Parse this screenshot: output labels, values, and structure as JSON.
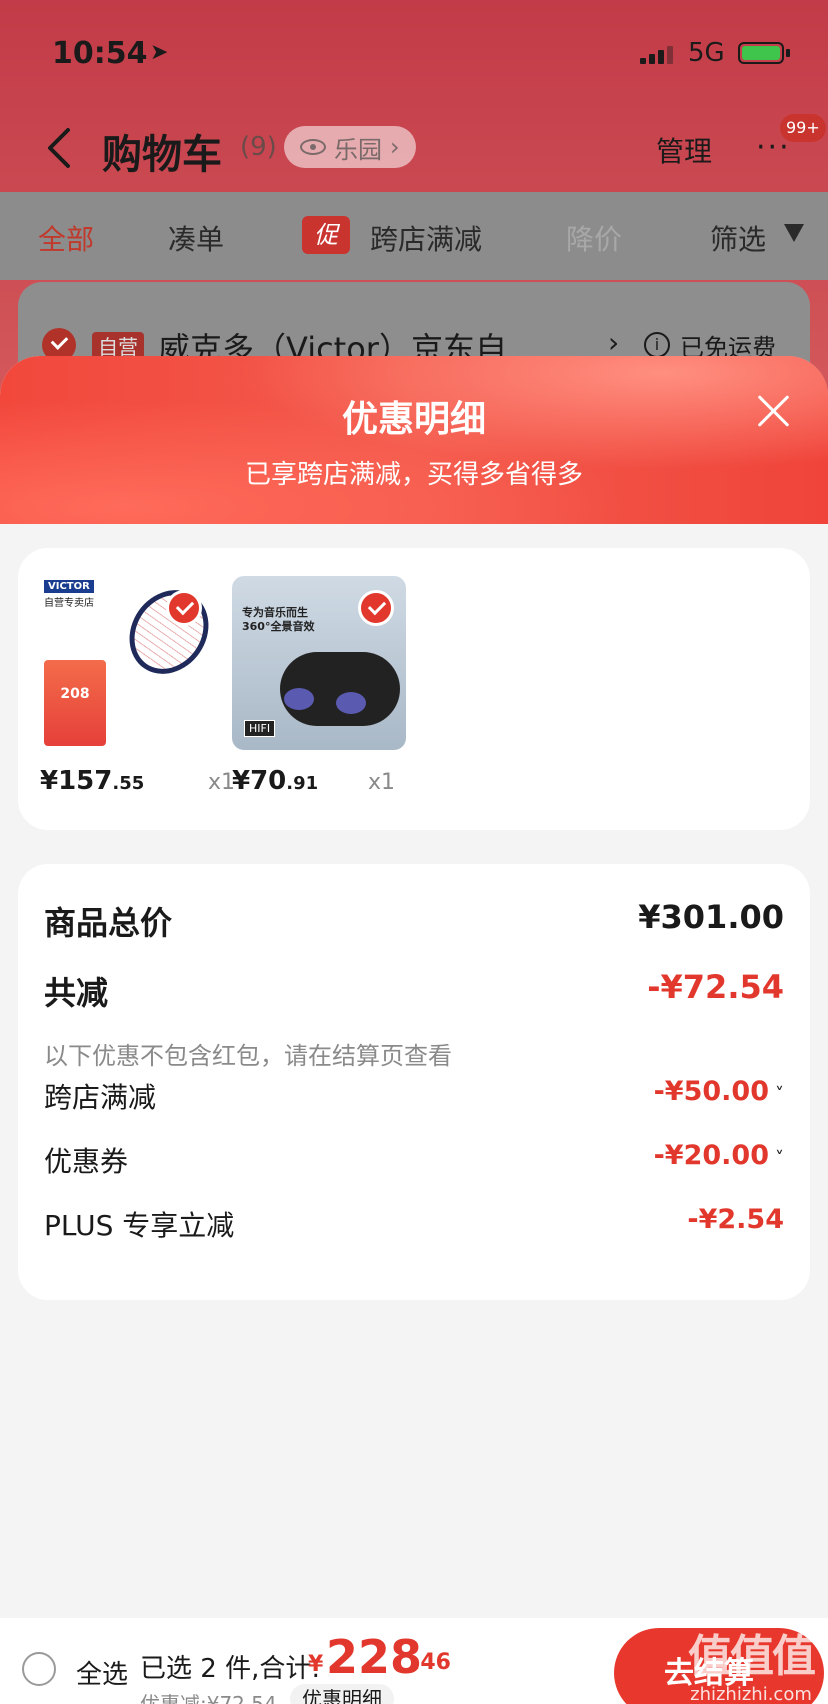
{
  "status": {
    "time": "10:54",
    "network": "5G"
  },
  "nav": {
    "title": "购物车",
    "count": "(9)",
    "paradise_label": "乐园",
    "manage": "管理",
    "badge": "99+"
  },
  "tabs": [
    {
      "label": "全部"
    },
    {
      "label": "凑单"
    },
    {
      "label": "跨店满减",
      "tag": "促"
    },
    {
      "label": "降价"
    },
    {
      "label": "筛选"
    }
  ],
  "shop": {
    "self_tag": "自营",
    "name": "威克多（Victor）京东自…",
    "shipping": "已免运费"
  },
  "sheet": {
    "title": "优惠明细",
    "subtitle": "已享跨店满减，买得多省得多",
    "products": [
      {
        "price_int": "¥157",
        "price_dec": ".55",
        "qty": "x1",
        "image": {
          "brand": "VICTOR",
          "store": "自营专卖店",
          "promo": "208"
        }
      },
      {
        "price_int": "¥70",
        "price_dec": ".91",
        "qty": "x1",
        "image": {
          "line1": "专为音乐而生",
          "line2": "360°全景音效",
          "badge": "HIFI"
        }
      }
    ],
    "summary": {
      "goods_total_label": "商品总价",
      "goods_total_value": "¥301.00",
      "reduction_label": "共减",
      "reduction_value": "-¥72.54",
      "note": "以下优惠不包含红包，请在结算页查看",
      "items": [
        {
          "label": "跨店满减",
          "value": "-¥50.00",
          "expandable": true
        },
        {
          "label": "优惠券",
          "value": "-¥20.00",
          "expandable": true
        },
        {
          "label": "PLUS 专享立减",
          "value": "-¥2.54",
          "expandable": false
        }
      ]
    }
  },
  "bottom": {
    "select_all": "全选",
    "selected_label": "已选 2 件,合计:",
    "total_yen": "¥",
    "total_int": "228",
    "total_dec": ".46",
    "discount_text": "优惠减:¥72.54",
    "detail_chip": "优惠明细",
    "checkout": "去结算"
  },
  "watermark": {
    "main": "值值值",
    "site": "zhizhizhi.com"
  },
  "colors": {
    "accent": "#e2372c",
    "header_gradient": "#f2483c"
  }
}
